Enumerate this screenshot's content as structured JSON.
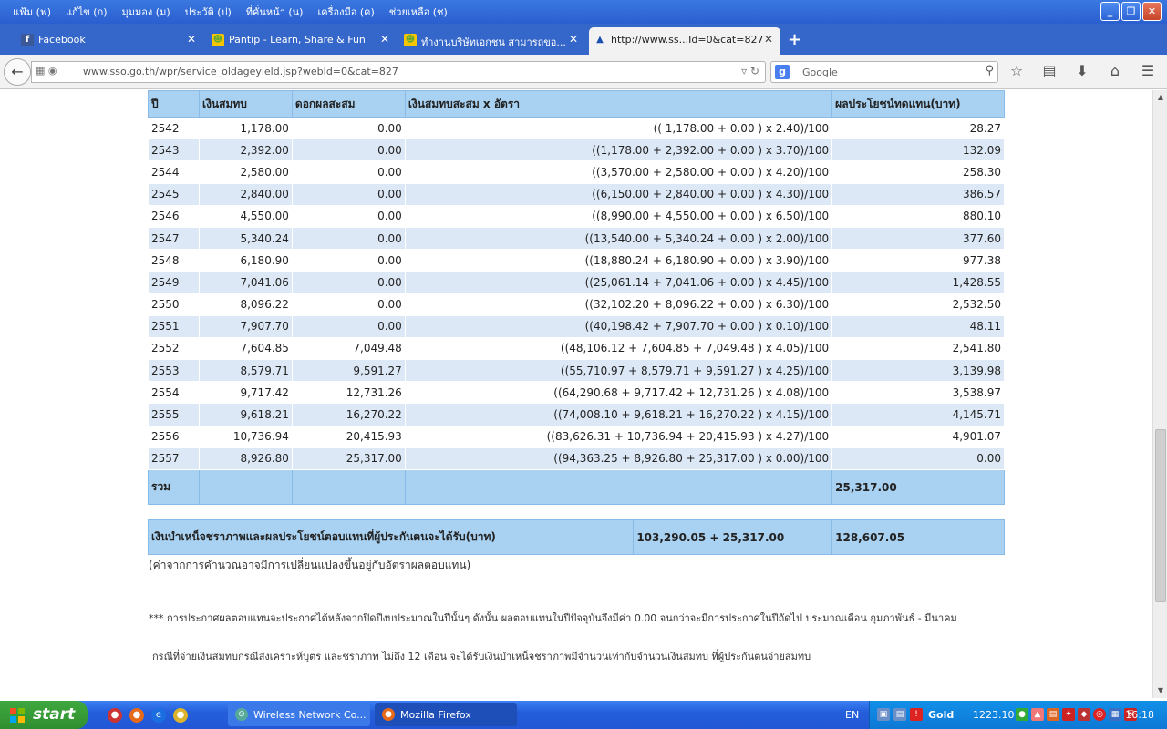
{
  "menu": [
    "แฟ้ม (ฟ)",
    "แก้ไข (ก)",
    "มุมมอง (ม)",
    "ประวัติ (ป)",
    "ที่คั่นหน้า (น)",
    "เครื่องมือ (ค)",
    "ช่วยเหลือ (ช)"
  ],
  "tabs": [
    {
      "label": "Facebook",
      "icon": "f"
    },
    {
      "label": "Pantip - Learn, Share & Fun",
      "icon": "☻"
    },
    {
      "label": "ทำงานบริษัทเอกชน สามารถขอ...",
      "icon": "☻"
    },
    {
      "label": "http://www.ss...Id=0&cat=827",
      "icon": "▲"
    }
  ],
  "url": "www.sso.go.th/wpr/service_oldageyield.jsp?webId=0&cat=827",
  "search_placeholder": "Google",
  "table": {
    "headers": [
      "ปี",
      "เงินสมทบ",
      "ดอกผลสะสม",
      "เงินสมทบสะสม x อัตรา",
      "ผลประโยชน์ทดแทน(บาท)"
    ],
    "rows": [
      [
        "2542",
        "1,178.00",
        "0.00",
        "(( 1,178.00 + 0.00 ) x 2.40)/100",
        "28.27"
      ],
      [
        "2543",
        "2,392.00",
        "0.00",
        "((1,178.00 + 2,392.00 + 0.00 ) x 3.70)/100",
        "132.09"
      ],
      [
        "2544",
        "2,580.00",
        "0.00",
        "((3,570.00 + 2,580.00 + 0.00 ) x 4.20)/100",
        "258.30"
      ],
      [
        "2545",
        "2,840.00",
        "0.00",
        "((6,150.00 + 2,840.00 + 0.00 ) x 4.30)/100",
        "386.57"
      ],
      [
        "2546",
        "4,550.00",
        "0.00",
        "((8,990.00 + 4,550.00 + 0.00 ) x 6.50)/100",
        "880.10"
      ],
      [
        "2547",
        "5,340.24",
        "0.00",
        "((13,540.00 + 5,340.24 + 0.00 ) x 2.00)/100",
        "377.60"
      ],
      [
        "2548",
        "6,180.90",
        "0.00",
        "((18,880.24 + 6,180.90 + 0.00 ) x 3.90)/100",
        "977.38"
      ],
      [
        "2549",
        "7,041.06",
        "0.00",
        "((25,061.14 + 7,041.06 + 0.00 ) x 4.45)/100",
        "1,428.55"
      ],
      [
        "2550",
        "8,096.22",
        "0.00",
        "((32,102.20 + 8,096.22 + 0.00 ) x 6.30)/100",
        "2,532.50"
      ],
      [
        "2551",
        "7,907.70",
        "0.00",
        "((40,198.42 + 7,907.70 + 0.00 ) x 0.10)/100",
        "48.11"
      ],
      [
        "2552",
        "7,604.85",
        "7,049.48",
        "((48,106.12 + 7,604.85 + 7,049.48 ) x 4.05)/100",
        "2,541.80"
      ],
      [
        "2553",
        "8,579.71",
        "9,591.27",
        "((55,710.97 + 8,579.71 + 9,591.27 ) x 4.25)/100",
        "3,139.98"
      ],
      [
        "2554",
        "9,717.42",
        "12,731.26",
        "((64,290.68 + 9,717.42 + 12,731.26 ) x 4.08)/100",
        "3,538.97"
      ],
      [
        "2555",
        "9,618.21",
        "16,270.22",
        "((74,008.10 + 9,618.21 + 16,270.22 ) x 4.15)/100",
        "4,145.71"
      ],
      [
        "2556",
        "10,736.94",
        "20,415.93",
        "((83,626.31 + 10,736.94 + 20,415.93 ) x 4.27)/100",
        "4,901.07"
      ],
      [
        "2557",
        "8,926.80",
        "25,317.00",
        "((94,363.25 + 8,926.80 + 25,317.00 ) x 0.00)/100",
        "0.00"
      ]
    ],
    "total_label": "รวม",
    "total_value": "25,317.00"
  },
  "summary": {
    "label": "เงินบำเหน็จชราภาพและผลประโยชน์ตอบแทนที่ผู้ประกันตนจะได้รับ(บาท)",
    "formula": "103,290.05 + 25,317.00",
    "value": "128,607.05"
  },
  "note": "(ค่าจากการคำนวณอาจมีการเปลี่ยนแปลงขึ้นอยู่กับอัตราผลตอบแทน)",
  "remark1": "*** การประกาศผลตอบแทนจะประกาศได้หลังจากปิดปีงบประมาณในปีนั้นๆ ดังนั้น ผลตอบแทนในปีปัจจุบันจึงมีค่า 0.00 จนกว่าจะมีการประกาศในปีถัดไป ประมาณเดือน กุมภาพันธ์ - มีนาคม",
  "remark2": "กรณีที่จ่ายเงินสมทบกรณีสงเคราะห์บุตร และชราภาพ ไม่ถึง 12 เดือน จะได้รับเงินบำเหน็จชราภาพมีจำนวนเท่ากับจำนวนเงินสมทบ ที่ผู้ประกันตนจ่ายสมทบ",
  "taskbar": {
    "start": "start",
    "tasks": [
      "Wireless Network Co...",
      "Mozilla Firefox"
    ],
    "lang": "EN",
    "gold_label": "Gold",
    "gold_value": "1223.10",
    "clock": "16:18"
  }
}
